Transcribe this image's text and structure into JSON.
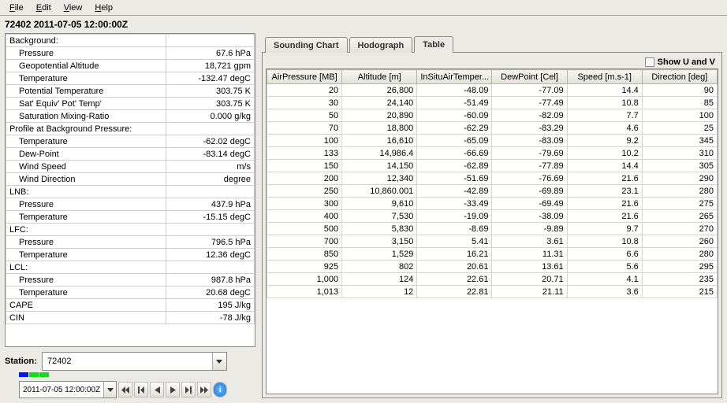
{
  "menu": {
    "file": "File",
    "edit": "Edit",
    "view": "View",
    "help": "Help"
  },
  "title": "72402 2011-07-05 12:00:00Z",
  "props": {
    "sections": [
      {
        "label": "Background:",
        "rows": [
          {
            "name": "Pressure",
            "value": "67.6 hPa"
          },
          {
            "name": "Geopotential Altitude",
            "value": "18,721 gpm"
          },
          {
            "name": "Temperature",
            "value": "-132.47 degC"
          },
          {
            "name": "Potential Temperature",
            "value": "303.75 K"
          },
          {
            "name": "Sat' Equiv' Pot' Temp'",
            "value": "303.75 K"
          },
          {
            "name": "Saturation Mixing-Ratio",
            "value": "0.000 g/kg"
          }
        ]
      },
      {
        "label": "Profile at Background Pressure:",
        "rows": [
          {
            "name": "Temperature",
            "value": "-62.02 degC"
          },
          {
            "name": "Dew-Point",
            "value": "-83.14 degC"
          },
          {
            "name": "Wind Speed",
            "value": "m/s"
          },
          {
            "name": "Wind Direction",
            "value": "degree"
          }
        ]
      },
      {
        "label": "LNB:",
        "rows": [
          {
            "name": "Pressure",
            "value": "437.9 hPa"
          },
          {
            "name": "Temperature",
            "value": "-15.15 degC"
          }
        ]
      },
      {
        "label": "LFC:",
        "rows": [
          {
            "name": "Pressure",
            "value": "796.5 hPa"
          },
          {
            "name": "Temperature",
            "value": "12.36 degC"
          }
        ]
      },
      {
        "label": "LCL:",
        "rows": [
          {
            "name": "Pressure",
            "value": "987.8 hPa"
          },
          {
            "name": "Temperature",
            "value": "20.68 degC"
          }
        ]
      }
    ],
    "tail": [
      {
        "name": "CAPE",
        "value": "195 J/kg"
      },
      {
        "name": "CIN",
        "value": "-78 J/kg"
      }
    ]
  },
  "station": {
    "label": "Station:",
    "value": "72402"
  },
  "time": {
    "value": "2011-07-05 12:00:00Z"
  },
  "tabs": {
    "sounding": "Sounding Chart",
    "hodograph": "Hodograph",
    "table": "Table"
  },
  "showuv": "Show U and V",
  "grid": {
    "headers": [
      "AirPressure [MB]",
      "Altitude [m]",
      "InSituAirTemper...",
      "DewPoint [Cel]",
      "Speed [m.s-1]",
      "Direction [deg]"
    ],
    "rows": [
      [
        "20",
        "26,800",
        "-48.09",
        "-77.09",
        "14.4",
        "90"
      ],
      [
        "30",
        "24,140",
        "-51.49",
        "-77.49",
        "10.8",
        "85"
      ],
      [
        "50",
        "20,890",
        "-60.09",
        "-82.09",
        "7.7",
        "100"
      ],
      [
        "70",
        "18,800",
        "-62.29",
        "-83.29",
        "4.6",
        "25"
      ],
      [
        "100",
        "16,610",
        "-65.09",
        "-83.09",
        "9.2",
        "345"
      ],
      [
        "133",
        "14,986.4",
        "-66.69",
        "-79.69",
        "10.2",
        "310"
      ],
      [
        "150",
        "14,150",
        "-62.89",
        "-77.89",
        "14.4",
        "305"
      ],
      [
        "200",
        "12,340",
        "-51.69",
        "-76.69",
        "21.6",
        "290"
      ],
      [
        "250",
        "10,860.001",
        "-42.89",
        "-69.89",
        "23.1",
        "280"
      ],
      [
        "300",
        "9,610",
        "-33.49",
        "-69.49",
        "21.6",
        "275"
      ],
      [
        "400",
        "7,530",
        "-19.09",
        "-38.09",
        "21.6",
        "265"
      ],
      [
        "500",
        "5,830",
        "-8.69",
        "-9.89",
        "9.7",
        "270"
      ],
      [
        "700",
        "3,150",
        "5.41",
        "3.61",
        "10.8",
        "260"
      ],
      [
        "850",
        "1,529",
        "16.21",
        "11.31",
        "6.6",
        "280"
      ],
      [
        "925",
        "802",
        "20.61",
        "13.61",
        "5.6",
        "295"
      ],
      [
        "1,000",
        "124",
        "22.61",
        "20.71",
        "4.1",
        "235"
      ],
      [
        "1,013",
        "12",
        "22.81",
        "21.11",
        "3.6",
        "215"
      ]
    ]
  }
}
